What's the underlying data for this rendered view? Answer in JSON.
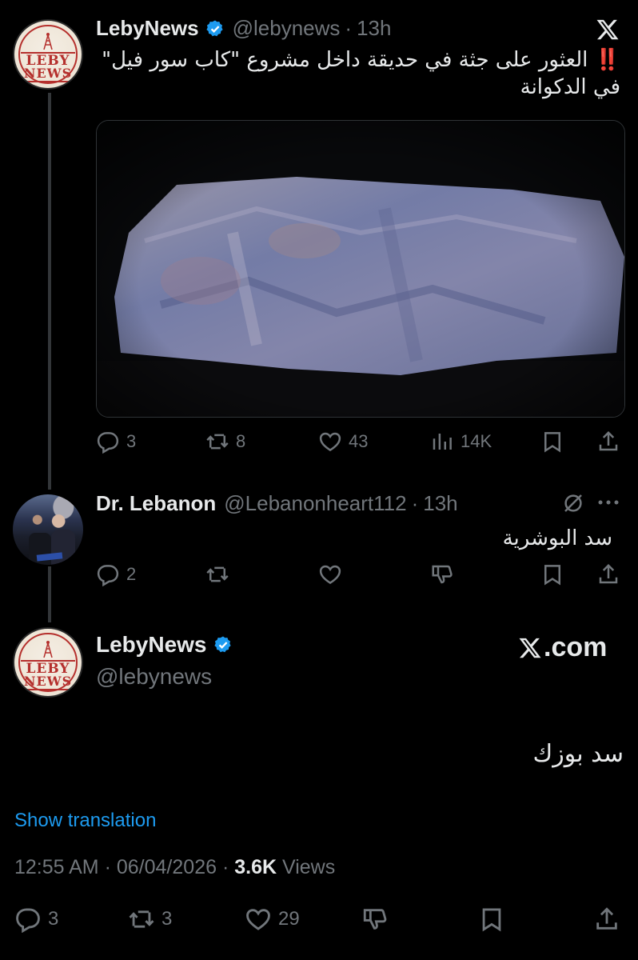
{
  "tweet1": {
    "display_name": "LebyNews",
    "handle": "@lebynews",
    "time": "13h",
    "excl": "‼️",
    "text": "العثور على جثة في حديقة داخل مشروع \"كاب سور فيل\" في الدكوانة",
    "actions": {
      "replies": "3",
      "retweets": "8",
      "likes": "43",
      "views": "14K"
    }
  },
  "reply": {
    "display_name": "Dr. Lebanon",
    "handle": "@Lebanonheart112",
    "time": "13h",
    "text": "سد البوشرية",
    "actions": {
      "replies": "2"
    }
  },
  "detail": {
    "display_name": "LebyNews",
    "handle": "@lebynews",
    "watermark": ".com",
    "text": "سد بوزك",
    "show_translation": "Show translation",
    "time": "12:55 AM",
    "date": "06/04/2026",
    "views_count": "3.6K",
    "views_label": "Views",
    "actions": {
      "replies": "3",
      "retweets": "3",
      "likes": "29"
    }
  },
  "avatar_logo": {
    "line1": "LEBY",
    "line2": "NEWS"
  },
  "colors": {
    "background": "#000000",
    "text": "#e7e9ea",
    "muted": "#71767b",
    "link": "#1d9bf0",
    "verified": "#1d9bf0",
    "alert": "#f4212e",
    "logo_red": "#b5302d"
  },
  "icons": [
    "x-logo-icon",
    "verified-badge-icon",
    "reply-icon",
    "retweet-icon",
    "like-icon",
    "views-icon",
    "bookmark-icon",
    "share-icon",
    "grok-icon",
    "more-icon",
    "dislike-icon"
  ]
}
